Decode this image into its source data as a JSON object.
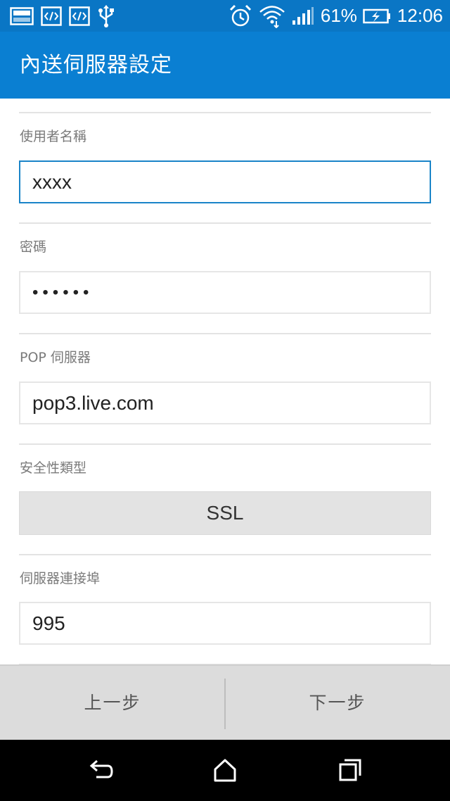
{
  "status_bar": {
    "battery_percent": "61%",
    "time": "12:06",
    "left_icons": [
      "image-icon",
      "code-icon",
      "code-icon",
      "usb-icon"
    ],
    "right_icons": [
      "alarm-icon",
      "wifi-icon",
      "signal-icon",
      "battery-charging-icon"
    ]
  },
  "action_bar": {
    "title": "內送伺服器設定"
  },
  "form": {
    "username": {
      "label": "使用者名稱",
      "value": "xxxx"
    },
    "password": {
      "label": "密碼",
      "value": "••••••"
    },
    "pop_server": {
      "label": "POP 伺服器",
      "value": "pop3.live.com"
    },
    "security_type": {
      "label": "安全性類型",
      "value": "SSL"
    },
    "server_port": {
      "label": "伺服器連接埠",
      "value": "995"
    }
  },
  "buttons": {
    "previous": "上一步",
    "next": "下一步"
  },
  "system_nav": {
    "icons": [
      "back-icon",
      "home-icon",
      "recents-icon"
    ]
  },
  "colors": {
    "status_bar": "#0a76c5",
    "action_bar": "#0a7fd2",
    "focus_border": "#1a84c8",
    "button_bar": "#dcdcdc"
  }
}
